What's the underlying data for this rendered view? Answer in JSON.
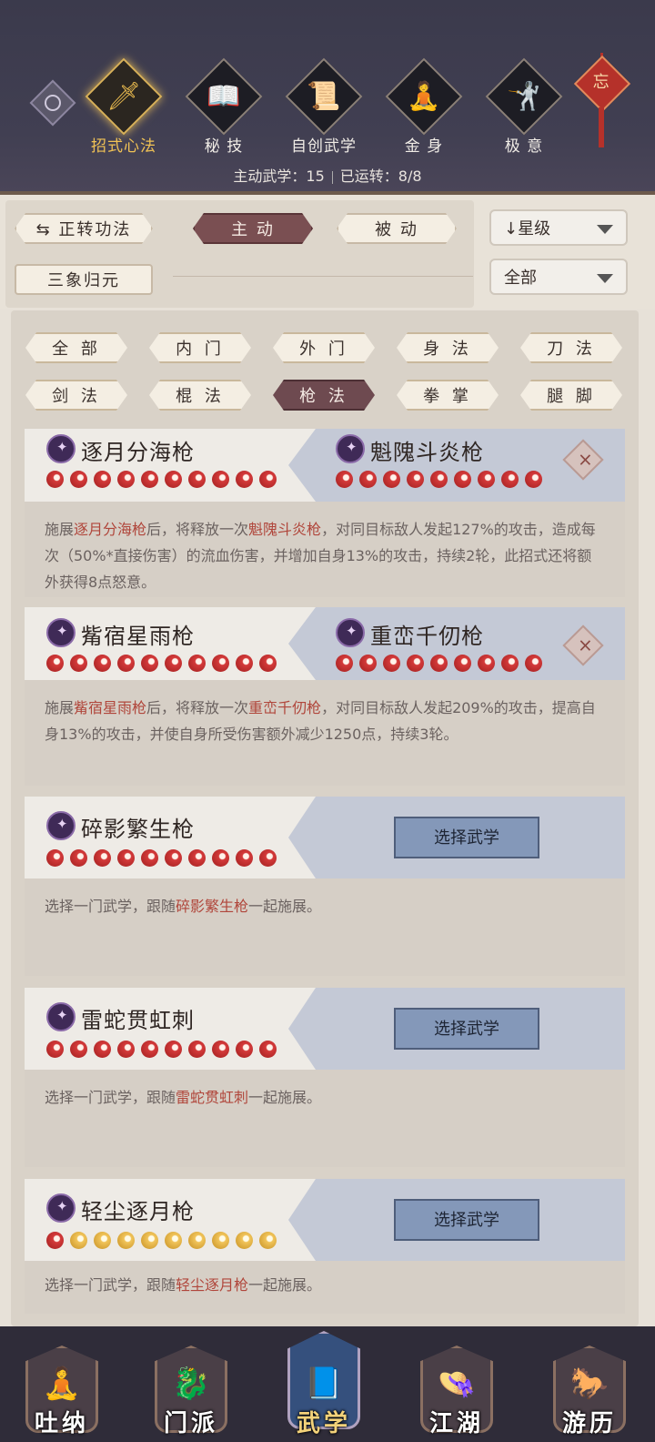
{
  "header": {
    "categories": [
      {
        "label": "招式心法",
        "icon": "sword-icon",
        "glyph": "🗡"
      },
      {
        "label": "秘 技",
        "icon": "book-icon",
        "glyph": "📖"
      },
      {
        "label": "自创武学",
        "icon": "scroll-icon",
        "glyph": "📜"
      },
      {
        "label": "金 身",
        "icon": "meditation-icon",
        "glyph": "🧘"
      },
      {
        "label": "极 意",
        "icon": "martial-pose-icon",
        "glyph": "🤺"
      }
    ],
    "charm_char": "忘",
    "stats": {
      "active_label": "主动武学：15",
      "running_label": "已运转：8/8"
    }
  },
  "controls": {
    "forward_mode": "正转功法",
    "active_tab": "主 动",
    "passive_tab": "被 动",
    "sanxiang": "三象归元",
    "sort": "星级",
    "filter_all": "全部"
  },
  "filters": [
    "全 部",
    "内 门",
    "外 门",
    "身 法",
    "刀 法",
    "剑 法",
    "棍 法",
    "枪 法",
    "拳 掌",
    "腿 脚"
  ],
  "cards": [
    {
      "left_name": "逐月分海枪",
      "right_name": "魁隗斗炎枪",
      "left_orbs": 10,
      "right_orbs": 9,
      "desc": [
        {
          "t": "施展"
        },
        {
          "t": "逐月分海枪",
          "hl": true
        },
        {
          "t": "后，将释放一次"
        },
        {
          "t": "魁隗斗炎枪",
          "hl": true
        },
        {
          "t": "，对同目标敌人发起127%的攻击，造成每次（50%*直接伤害）的流血伤害，并增加自身13%的攻击，持续2轮，此招式还将额外获得8点怒意。"
        }
      ]
    },
    {
      "left_name": "觜宿星雨枪",
      "right_name": "重峦千仞枪",
      "left_orbs": 10,
      "right_orbs": 9,
      "desc": [
        {
          "t": "施展"
        },
        {
          "t": "觜宿星雨枪",
          "hl": true
        },
        {
          "t": "后，将释放一次"
        },
        {
          "t": "重峦千仞枪",
          "hl": true
        },
        {
          "t": "，对同目标敌人发起209%的攻击，提高自身13%的攻击，并使自身所受伤害额外减少1250点，持续3轮。"
        }
      ]
    },
    {
      "left_name": "碎影繁生枪",
      "select_label": "选择武学",
      "left_orbs": 10,
      "desc": [
        {
          "t": "选择一门武学，跟随"
        },
        {
          "t": "碎影繁生枪",
          "hl": true
        },
        {
          "t": "一起施展。"
        }
      ]
    },
    {
      "left_name": "雷蛇贯虹刺",
      "select_label": "选择武学",
      "left_orbs": 10,
      "desc": [
        {
          "t": "选择一门武学，跟随"
        },
        {
          "t": "雷蛇贯虹刺",
          "hl": true
        },
        {
          "t": "一起施展。"
        }
      ]
    },
    {
      "left_name": "轻尘逐月枪",
      "select_label": "选择武学",
      "left_orbs": 1,
      "gold_orbs": 9,
      "desc": [
        {
          "t": "选择一门武学，跟随"
        },
        {
          "t": "轻尘逐月枪",
          "hl": true
        },
        {
          "t": "一起施展。"
        }
      ]
    }
  ],
  "bottom_nav": [
    {
      "label": "吐纳",
      "icon": "monk-icon",
      "glyph": "🧘"
    },
    {
      "label": "门派",
      "icon": "sect-icon",
      "glyph": "🐉"
    },
    {
      "label": "武学",
      "icon": "manual-icon",
      "glyph": "📘"
    },
    {
      "label": "江湖",
      "icon": "straw-hat-icon",
      "glyph": "👒"
    },
    {
      "label": "游历",
      "icon": "horse-icon",
      "glyph": "🐎"
    }
  ],
  "colors": {
    "accent_gold": "#f0c255",
    "highlight_red": "#b0463b",
    "active_tab": "#7a4f52"
  }
}
